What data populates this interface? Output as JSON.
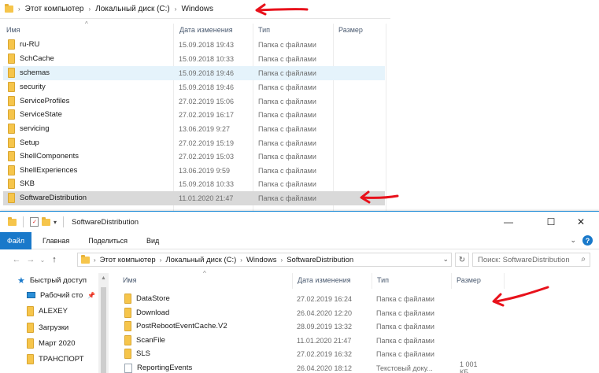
{
  "back_window": {
    "breadcrumb": [
      "Этот компьютер",
      "Локальный диск (C:)",
      "Windows"
    ],
    "columns": [
      "Имя",
      "Дата изменения",
      "Тип",
      "Размер"
    ],
    "rows": [
      {
        "name": "ru-RU",
        "date": "15.09.2018 19:43",
        "type": "Папка с файлами"
      },
      {
        "name": "SchCache",
        "date": "15.09.2018 10:33",
        "type": "Папка с файлами"
      },
      {
        "name": "schemas",
        "date": "15.09.2018 19:46",
        "type": "Папка с файлами"
      },
      {
        "name": "security",
        "date": "15.09.2018 19:46",
        "type": "Папка с файлами"
      },
      {
        "name": "ServiceProfiles",
        "date": "27.02.2019 15:06",
        "type": "Папка с файлами"
      },
      {
        "name": "ServiceState",
        "date": "27.02.2019 16:17",
        "type": "Папка с файлами"
      },
      {
        "name": "servicing",
        "date": "13.06.2019 9:27",
        "type": "Папка с файлами"
      },
      {
        "name": "Setup",
        "date": "27.02.2019 15:19",
        "type": "Папка с файлами"
      },
      {
        "name": "ShellComponents",
        "date": "27.02.2019 15:03",
        "type": "Папка с файлами"
      },
      {
        "name": "ShellExperiences",
        "date": "13.06.2019 9:59",
        "type": "Папка с файлами"
      },
      {
        "name": "SKB",
        "date": "15.09.2018 10:33",
        "type": "Папка с файлами"
      },
      {
        "name": "SoftwareDistribution",
        "date": "11.01.2020 21:47",
        "type": "Папка с файлами"
      }
    ]
  },
  "front_window": {
    "title": "SoftwareDistribution",
    "ribbon_tabs": [
      "Файл",
      "Главная",
      "Поделиться",
      "Вид"
    ],
    "breadcrumb": [
      "Этот компьютер",
      "Локальный диск (C:)",
      "Windows",
      "SoftwareDistribution"
    ],
    "search_placeholder": "Поиск: SoftwareDistribution",
    "columns": [
      "Имя",
      "Дата изменения",
      "Тип",
      "Размер"
    ],
    "nav_items": [
      "Быстрый доступ",
      "Рабочий сто",
      "ALEXEY",
      "Загрузки",
      "Март 2020",
      "ТРАНСПОРТ"
    ],
    "rows": [
      {
        "name": "DataStore",
        "date": "27.02.2019 16:24",
        "type": "Папка с файлами",
        "size": ""
      },
      {
        "name": "Download",
        "date": "26.04.2020 12:20",
        "type": "Папка с файлами",
        "size": ""
      },
      {
        "name": "PostRebootEventCache.V2",
        "date": "28.09.2019 13:32",
        "type": "Папка с файлами",
        "size": ""
      },
      {
        "name": "ScanFile",
        "date": "11.01.2020 21:47",
        "type": "Папка с файлами",
        "size": ""
      },
      {
        "name": "SLS",
        "date": "27.02.2019 16:32",
        "type": "Папка с файлами",
        "size": ""
      },
      {
        "name": "ReportingEvents",
        "date": "26.04.2020 18:12",
        "type": "Текстовый доку...",
        "size": "1 001 КБ"
      }
    ]
  },
  "colors": {
    "accent": "#1979ca",
    "folder": "#f6c54b",
    "annotation_arrow": "#e8111b"
  }
}
